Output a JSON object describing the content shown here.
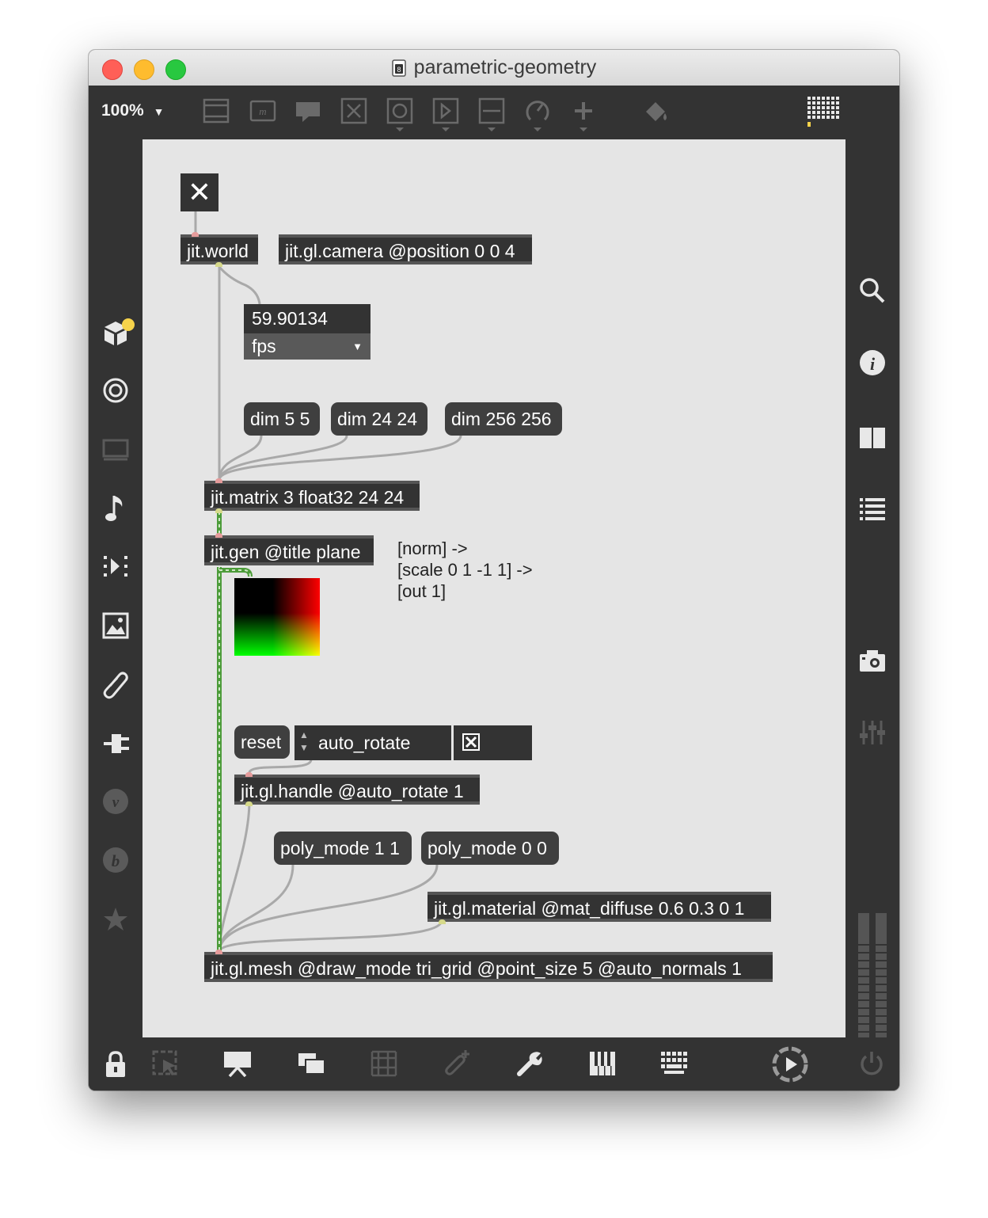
{
  "window": {
    "title": "parametric-geometry"
  },
  "toolbar": {
    "zoom": "100%",
    "icons": [
      "presentation-toggle-icon",
      "comment-object-icon",
      "message-object-icon",
      "button-object-icon",
      "toggle-object-icon",
      "number-object-icon",
      "slider-object-icon",
      "dial-object-icon",
      "add-object-icon",
      "paint-bucket-icon",
      "grid-pattern-icon"
    ]
  },
  "left_sidebar": {
    "icons": [
      "object-browser-icon",
      "target-icon",
      "monitor-icon",
      "music-note-icon",
      "playlist-icon",
      "image-icon",
      "paperclip-icon",
      "plug-icon",
      "vizzie-icon",
      "beap-icon",
      "favorites-icon"
    ]
  },
  "right_sidebar": {
    "icons": [
      "search-icon",
      "info-icon",
      "reference-book-icon",
      "list-icon",
      "camera-icon",
      "mixer-icon",
      "level-meter-icon"
    ]
  },
  "bottom_bar": {
    "icons": [
      "lock-icon",
      "presentation-mode-icon",
      "present-icon",
      "new-view-icon",
      "grid-icon",
      "add-attachment-icon",
      "wrench-icon",
      "piano-keys-icon",
      "keyboard-icon",
      "transport-icon",
      "power-icon"
    ]
  },
  "patch": {
    "toggle_world": {
      "checked": true,
      "symbol": "✕"
    },
    "jit_world": "jit.world",
    "jit_camera": "jit.gl.camera @position 0 0 4",
    "fps_value": "59.90134",
    "fps_unit": "fps",
    "dim_5": "dim 5 5",
    "dim_24": "dim 24 24",
    "dim_256": "dim 256 256",
    "jit_matrix": "jit.matrix 3 float32 24 24",
    "jit_gen": "jit.gen @title plane",
    "gen_comment": "[norm] ->\n[scale 0 1 -1 1] ->\n[out 1]",
    "reset": "reset",
    "auto_rotate_label": "auto_rotate",
    "auto_rotate_checked": true,
    "jit_handle": "jit.gl.handle @auto_rotate 1",
    "poly_mode_1": "poly_mode 1 1",
    "poly_mode_0": "poly_mode 0 0",
    "jit_material": "jit.gl.material @mat_diffuse 0.6 0.3 0 1",
    "jit_mesh": "jit.gl.mesh @draw_mode tri_grid @point_size 5 @auto_normals 1"
  },
  "colors": {
    "window_chrome": "#333333",
    "canvas_background": "#e5e5e5",
    "object_box": "#333333",
    "message_box": "#3f3f3f",
    "patch_cord": "#a9a9a9",
    "matrix_cord": "#4d9c3a",
    "close_light": "#ff5f57",
    "minimize_light": "#febc2e",
    "zoom_light": "#28c840",
    "accent_yellow": "#f6d34b"
  }
}
